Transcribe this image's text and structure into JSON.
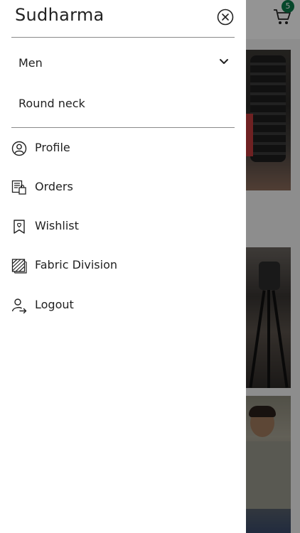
{
  "drawer": {
    "title": "Sudharma",
    "categories": [
      {
        "label": "Men",
        "expandable": true
      },
      {
        "label": "Round neck",
        "expandable": false
      }
    ],
    "menu": [
      {
        "label": "Profile",
        "icon": "user-icon"
      },
      {
        "label": "Orders",
        "icon": "orders-icon"
      },
      {
        "label": "Wishlist",
        "icon": "wishlist-icon"
      },
      {
        "label": "Fabric Division",
        "icon": "fabric-icon"
      },
      {
        "label": "Logout",
        "icon": "logout-icon"
      }
    ]
  },
  "header": {
    "cart_count": "5"
  },
  "colors": {
    "badge": "#0b7a4a",
    "text": "#222222",
    "overlay": "rgba(0,0,0,0.42)"
  }
}
